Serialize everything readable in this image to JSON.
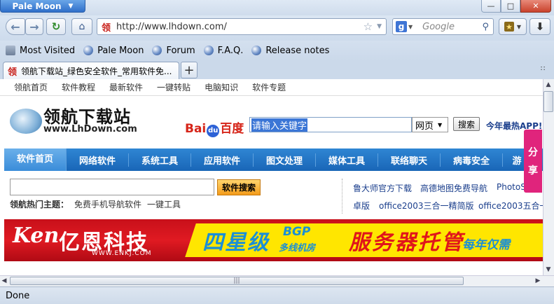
{
  "window": {
    "app_menu_label": "Pale Moon",
    "controls": {
      "minimize": "—",
      "maximize": "□",
      "close": "✕"
    }
  },
  "navigation": {
    "url": "http://www.lhdown.com/",
    "site_favicon": "领",
    "search_engine_icon": "g",
    "search_placeholder": "Google"
  },
  "bookmarks": [
    "Most Visited",
    "Pale Moon",
    "Forum",
    "F.A.Q.",
    "Release notes"
  ],
  "tabs": [
    {
      "favicon": "领",
      "title": "领航下载站_绿色安全软件_常用软件免..."
    }
  ],
  "page": {
    "top_nav": [
      "领航首页",
      "软件教程",
      "最新软件",
      "一键转贴",
      "电脑知识",
      "软件专题"
    ],
    "logo": {
      "cn": "领航下载站",
      "en": "www.LhDown.com"
    },
    "baidu": {
      "bai": "Bai",
      "du": "du",
      "cn": "百度",
      "input_value": "请输入关键字",
      "select": "网页",
      "button": "搜索"
    },
    "promo": "今年最热APP!",
    "main_nav": [
      "软件首页",
      "网络软件",
      "系统工具",
      "应用软件",
      "图文处理",
      "媒体工具",
      "联络聊天",
      "病毒安全",
      "游"
    ],
    "site_search_button": "软件搜索",
    "hot_label": "领航热门主题：",
    "hot_links": [
      "免费手机导航软件",
      "一键工具"
    ],
    "right_links_row1": [
      "鲁大师官方下载",
      "高德地图免费导航",
      "PhotoS"
    ],
    "right_links_row2": [
      "卓版",
      "office2003三合一精简版",
      "office2003五合一"
    ],
    "banner": {
      "brand_mark": "Ken",
      "brand_cn": "亿恩科技",
      "brand_en": "WWW.ENKJ.COM",
      "slogan1": "四星级",
      "bgp": "BGP",
      "multiline": "多线机房",
      "slogan2": "服务器托管",
      "slogan3": "每年仅需"
    },
    "share": [
      "分",
      "享"
    ]
  },
  "status": "Done"
}
